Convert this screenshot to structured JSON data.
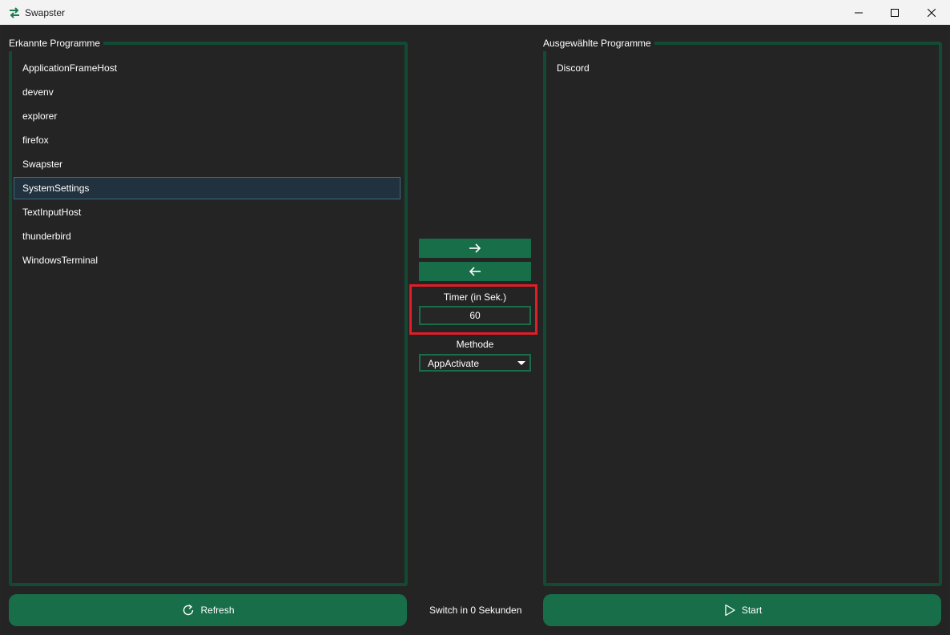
{
  "window": {
    "title": "Swapster",
    "icon": "swap-arrows-icon",
    "accent_color": "#176e49",
    "panel_border_color": "#124a33",
    "highlight_color": "#e11d26"
  },
  "left_panel": {
    "title": "Erkannte Programme",
    "items": [
      {
        "label": "ApplicationFrameHost",
        "selected": false
      },
      {
        "label": "devenv",
        "selected": false
      },
      {
        "label": "explorer",
        "selected": false
      },
      {
        "label": "firefox",
        "selected": false
      },
      {
        "label": "Swapster",
        "selected": false
      },
      {
        "label": "SystemSettings",
        "selected": true
      },
      {
        "label": "TextInputHost",
        "selected": false
      },
      {
        "label": "thunderbird",
        "selected": false
      },
      {
        "label": "WindowsTerminal",
        "selected": false
      }
    ]
  },
  "right_panel": {
    "title": "Ausgewählte Programme",
    "items": [
      {
        "label": "Discord",
        "selected": false
      }
    ]
  },
  "center": {
    "add_button_icon": "arrow-right-icon",
    "remove_button_icon": "arrow-left-icon",
    "timer_label": "Timer (in Sek.)",
    "timer_value": "60",
    "method_label": "Methode",
    "method_selected": "AppActivate",
    "status_text": "Switch in 0 Sekunden"
  },
  "buttons": {
    "refresh_label": "Refresh",
    "refresh_icon": "refresh-icon",
    "start_label": "Start",
    "start_icon": "play-icon"
  }
}
